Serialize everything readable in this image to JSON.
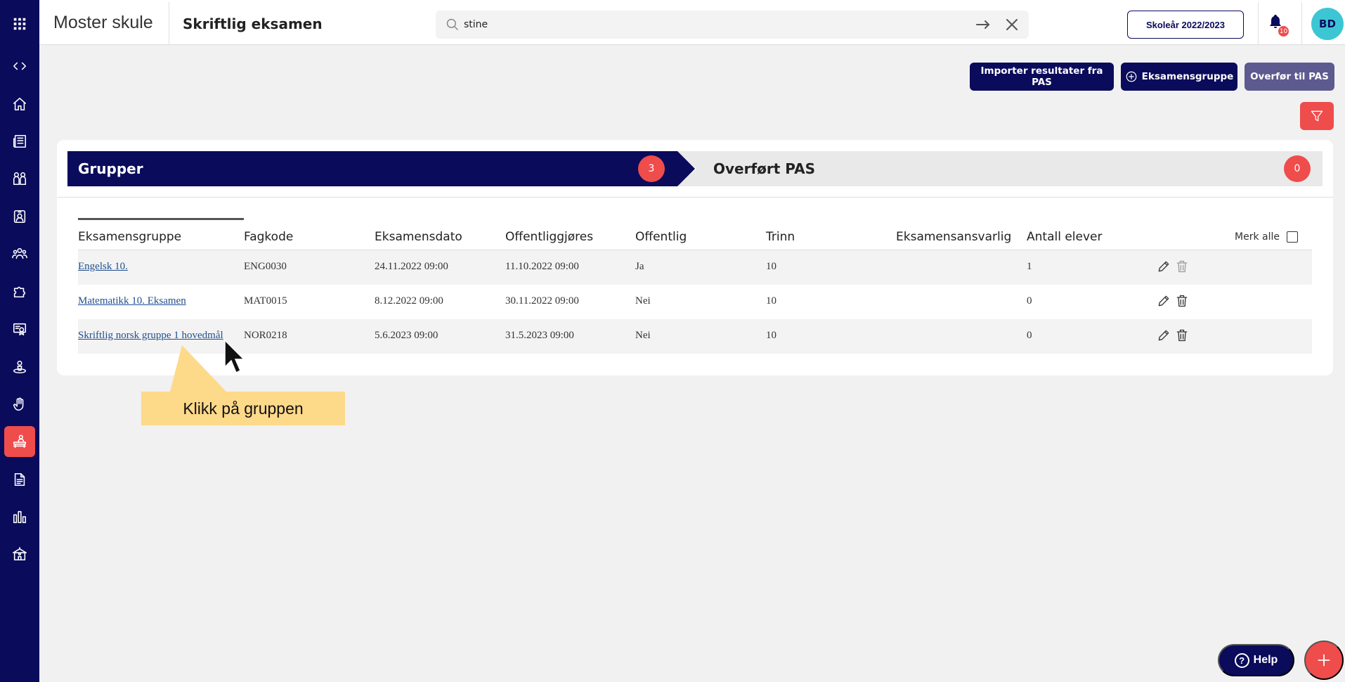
{
  "app": {
    "school_name": "Moster skule",
    "page_title": "Skriftlig eksamen"
  },
  "search": {
    "value": "stine",
    "placeholder": ""
  },
  "header": {
    "year_label": "Skoleår 2022/2023",
    "notification_count": "10",
    "avatar_initials": "BD"
  },
  "actions": {
    "import_label": "Importer resultater fra PAS",
    "add_group_label": "Eksamensgruppe",
    "transfer_label": "Overfør til PAS"
  },
  "tabs": [
    {
      "label": "Grupper",
      "count": "3"
    },
    {
      "label": "Overført PAS",
      "count": "0"
    }
  ],
  "table": {
    "columns": [
      "Eksamensgruppe",
      "Fagkode",
      "Eksamensdato",
      "Offentliggjøres",
      "Offentlig",
      "Trinn",
      "Eksamensansvarlig",
      "Antall elever"
    ],
    "select_all_label": "Merk alle",
    "rows": [
      {
        "group": "Engelsk 10.",
        "code": "ENG0030",
        "exam_date": "24.11.2022 09:00",
        "publish_date": "11.10.2022 09:00",
        "public": "Ja",
        "level": "10",
        "responsible": "",
        "students": "1"
      },
      {
        "group": "Matematikk 10. Eksamen",
        "code": "MAT0015",
        "exam_date": "8.12.2022 09:00",
        "publish_date": "30.11.2022 09:00",
        "public": "Nei",
        "level": "10",
        "responsible": "",
        "students": "0"
      },
      {
        "group": "Skriftlig norsk gruppe 1 hovedmål",
        "code": "NOR0218",
        "exam_date": "5.6.2023 09:00",
        "publish_date": "31.5.2023 09:00",
        "public": "Nei",
        "level": "10",
        "responsible": "",
        "students": "0"
      }
    ]
  },
  "callout": {
    "text": "Klikk på gruppen"
  },
  "help": {
    "label": "Help"
  },
  "colors": {
    "primary": "#0b0b5c",
    "accent": "#ef4c4c",
    "secondary": "#5c5a8f",
    "callout": "#fdd98a",
    "avatar": "#3cc6d4"
  },
  "icons": {
    "sidebar": [
      "apps-grid-icon",
      "code-toggle-icon",
      "home-icon",
      "news-icon",
      "people-icon",
      "badge-icon",
      "groups-icon",
      "puzzle-icon",
      "certificate-icon",
      "person-orbit-icon",
      "hand-raise-icon",
      "exam-desk-icon",
      "document-icon",
      "bar-chart-icon",
      "school-building-icon"
    ]
  }
}
